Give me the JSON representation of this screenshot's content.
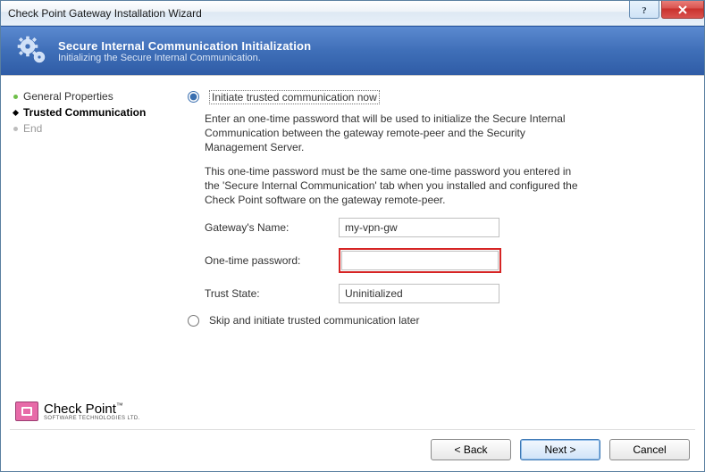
{
  "window": {
    "title": "Check Point Gateway Installation Wizard"
  },
  "banner": {
    "heading": "Secure Internal Communication Initialization",
    "subheading": "Initializing the Secure Internal Communication."
  },
  "sidebar": {
    "steps": [
      {
        "label": "General Properties",
        "state": "done"
      },
      {
        "label": "Trusted Communication",
        "state": "current"
      },
      {
        "label": "End",
        "state": "future"
      }
    ]
  },
  "content": {
    "option_now": "Initiate trusted communication now",
    "option_later": "Skip and initiate trusted communication later",
    "selected_option": "now",
    "para1": "Enter an one-time password that will be used to initialize the Secure Internal Communication between the gateway remote-peer and the Security Management Server.",
    "para2": "This one-time password must be the same one-time password you entered in the 'Secure Internal Communication' tab when you installed and configured the Check Point software on the gateway remote-peer.",
    "fields": {
      "gateway_name_label": "Gateway's Name:",
      "gateway_name_value": "my-vpn-gw",
      "otp_label": "One-time password:",
      "otp_value": "",
      "trust_state_label": "Trust State:",
      "trust_state_value": "Uninitialized"
    }
  },
  "logo": {
    "brand": "Check Point",
    "tagline": "SOFTWARE TECHNOLOGIES LTD.",
    "trademark": "™"
  },
  "buttons": {
    "back": "< Back",
    "next": "Next >",
    "cancel": "Cancel"
  }
}
